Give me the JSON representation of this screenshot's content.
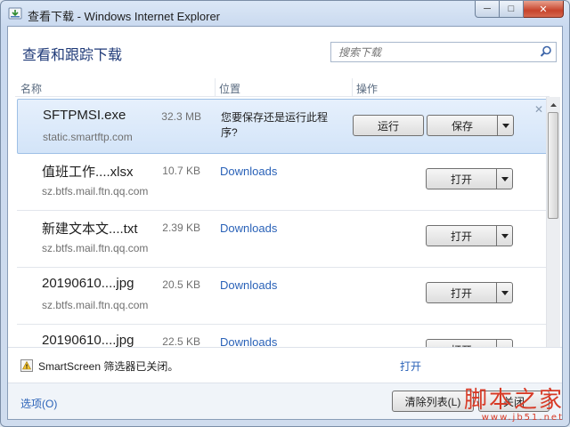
{
  "window": {
    "title": "查看下载 - Windows Internet Explorer",
    "minimize": "─",
    "maximize": "□",
    "close": "✕"
  },
  "header": {
    "title": "查看和跟踪下载",
    "search_placeholder": "搜索下载"
  },
  "columns": {
    "name": "名称",
    "location": "位置",
    "action": "操作"
  },
  "items": [
    {
      "name": "SFTPMSI.exe",
      "size": "32.3 MB",
      "source": "static.smartftp.com",
      "prompt": "您要保存还是运行此程序?",
      "run_label": "运行",
      "save_label": "保存",
      "dismiss": "✕"
    },
    {
      "name": "值班工作....xlsx",
      "size": "10.7 KB",
      "source": "sz.btfs.mail.ftn.qq.com",
      "location": "Downloads",
      "open_label": "打开"
    },
    {
      "name": "新建文本文....txt",
      "size": "2.39 KB",
      "source": "sz.btfs.mail.ftn.qq.com",
      "location": "Downloads",
      "open_label": "打开"
    },
    {
      "name": "20190610....jpg",
      "size": "20.5 KB",
      "source": "sz.btfs.mail.ftn.qq.com",
      "location": "Downloads",
      "open_label": "打开"
    },
    {
      "name": "20190610....jpg",
      "size": "22.5 KB",
      "source": "",
      "location": "Downloads",
      "open_label": "打开"
    }
  ],
  "footer": {
    "smartscreen_text": "SmartScreen 筛选器已关闭。",
    "smartscreen_link": "打开"
  },
  "bottom": {
    "options_label": "选项(O)",
    "clear_label": "清除列表(L)",
    "close_label": "关闭"
  },
  "watermark": {
    "main": "脚本之家",
    "url": "www.jb51.net"
  }
}
